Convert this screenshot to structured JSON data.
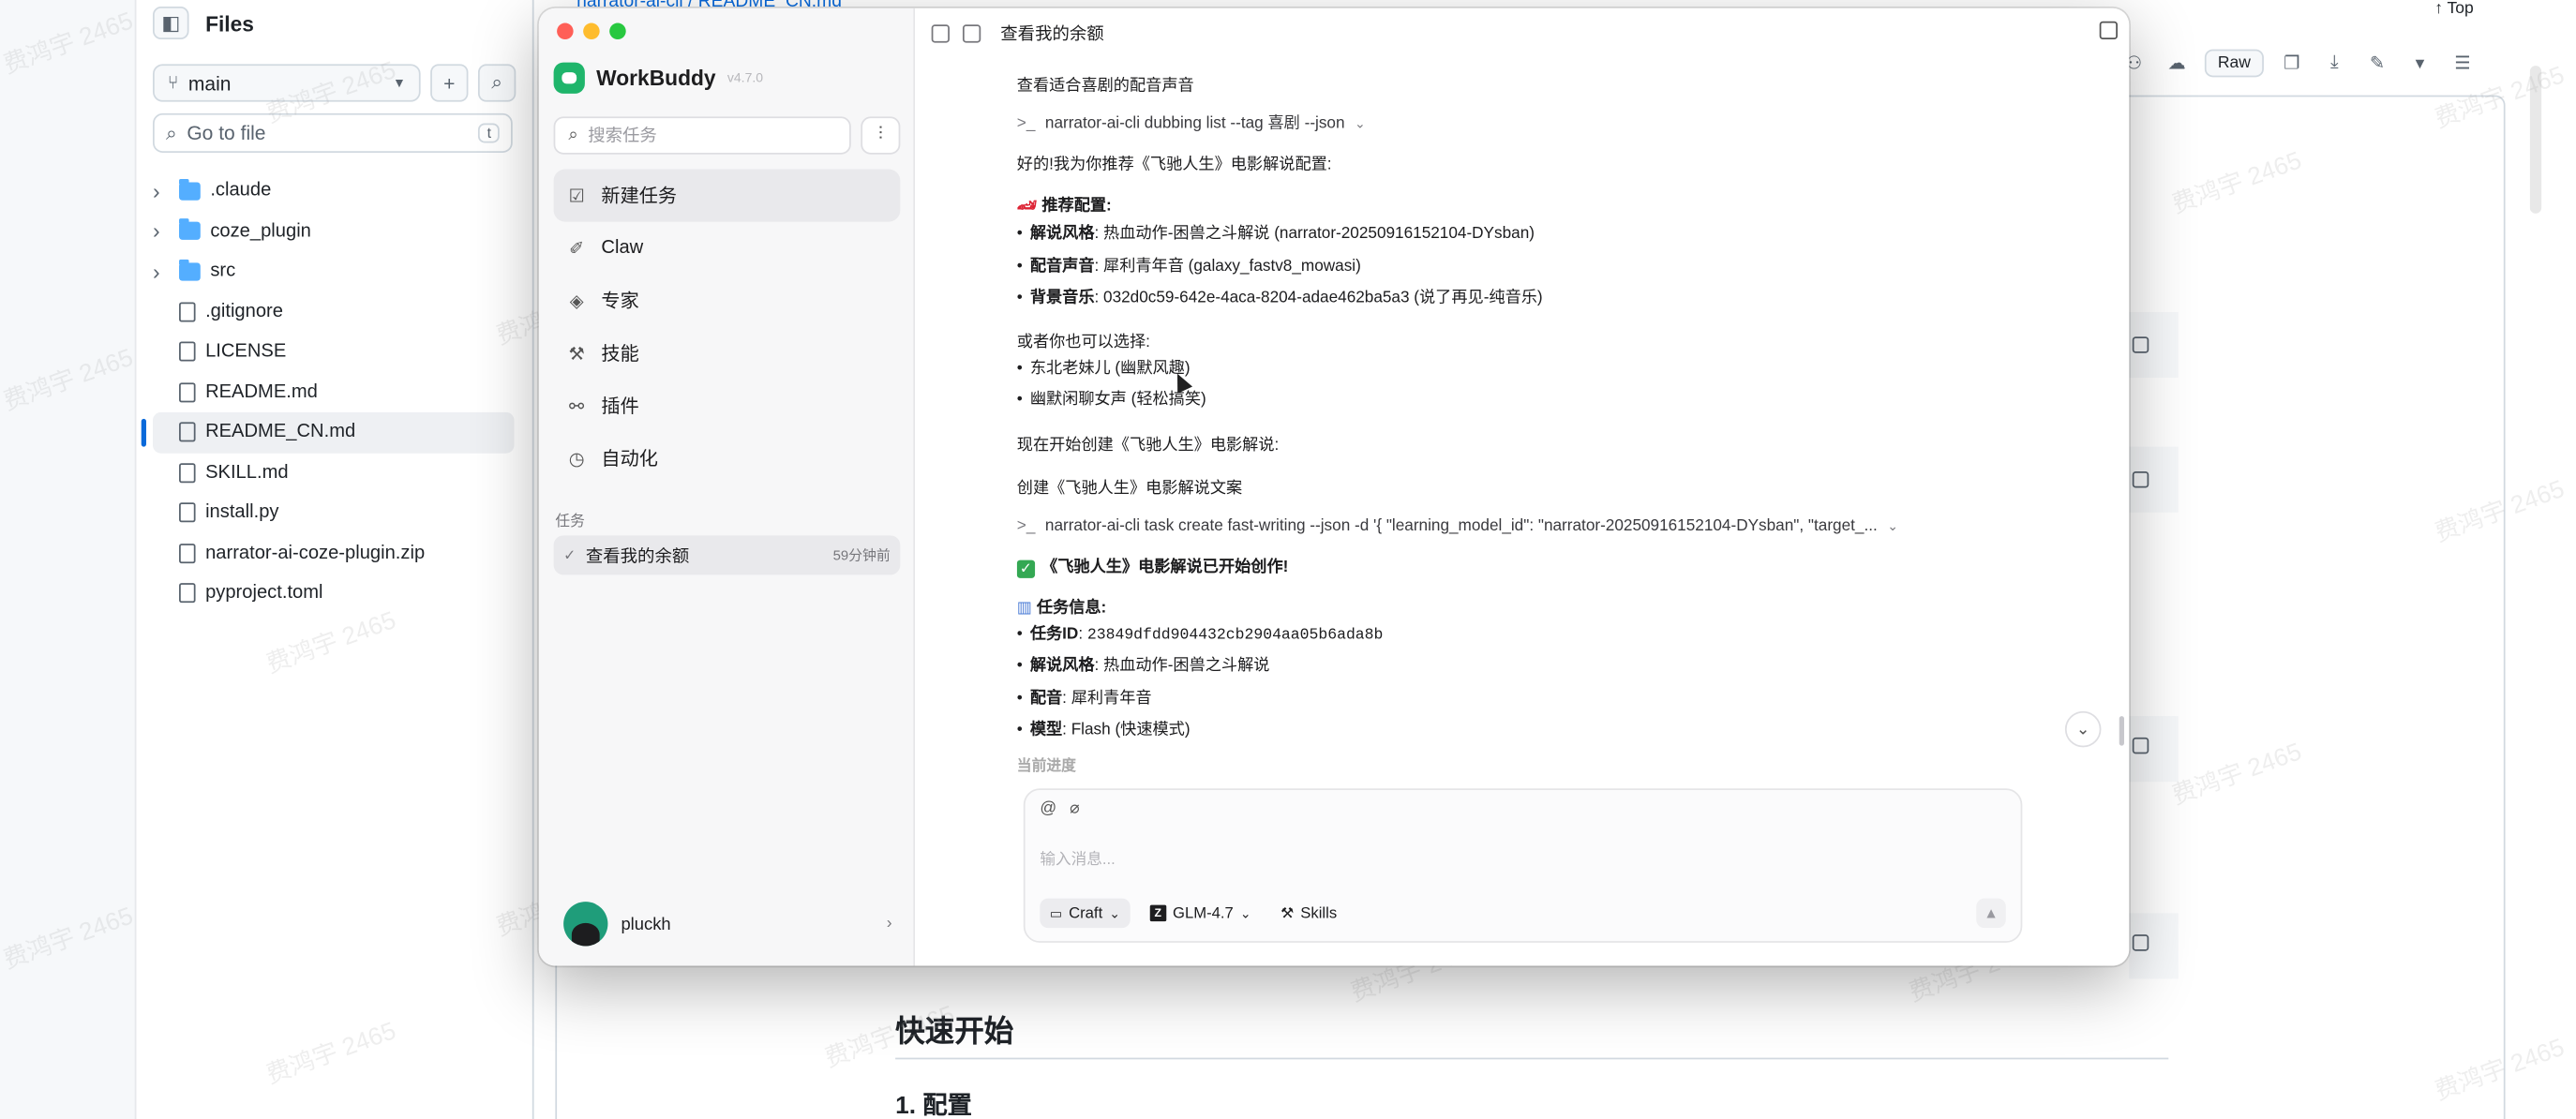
{
  "github": {
    "breadcrumb": "narrator-ai-cli / README_CN.md",
    "files_title": "Files",
    "branch": "main",
    "goto_placeholder": "Go to file",
    "goto_shortcut": "t",
    "tree": [
      {
        "name": ".claude",
        "type": "folder"
      },
      {
        "name": "coze_plugin",
        "type": "folder"
      },
      {
        "name": "src",
        "type": "folder"
      },
      {
        "name": ".gitignore",
        "type": "file"
      },
      {
        "name": "LICENSE",
        "type": "file"
      },
      {
        "name": "README.md",
        "type": "file"
      },
      {
        "name": "README_CN.md",
        "type": "file",
        "selected": true
      },
      {
        "name": "SKILL.md",
        "type": "file"
      },
      {
        "name": "install.py",
        "type": "file"
      },
      {
        "name": "narrator-ai-coze-plugin.zip",
        "type": "file"
      },
      {
        "name": "pyproject.toml",
        "type": "file"
      }
    ],
    "toolbar": {
      "raw": "Raw",
      "top": "Top"
    },
    "heading_quick_start": "快速开始",
    "heading_config": "1. 配置",
    "watermark": "费鸿宇 2465"
  },
  "workbuddy": {
    "app_name": "WorkBuddy",
    "version": "v4.7.0",
    "search_placeholder": "搜索任务",
    "nav": [
      {
        "label": "新建任务",
        "icon": "new-task-icon",
        "active": true
      },
      {
        "label": "Claw",
        "icon": "claw-icon"
      },
      {
        "label": "专家",
        "icon": "expert-icon"
      },
      {
        "label": "技能",
        "icon": "skills-icon"
      },
      {
        "label": "插件",
        "icon": "plugin-icon"
      },
      {
        "label": "自动化",
        "icon": "clock-icon"
      }
    ],
    "tasks_label": "任务",
    "task": {
      "title": "查看我的余额",
      "time": "59分钟前"
    },
    "user": "pluckh",
    "header_title": "查看我的余额",
    "chat": {
      "l1": "查看适合喜剧的配音声音",
      "cmd1": "narrator-ai-cli dubbing list --tag 喜剧 --json",
      "l2": "好的!我为你推荐《飞驰人生》电影解说配置:",
      "rec_title": "推荐配置:",
      "rec": [
        {
          "k": "解说风格",
          "v": ": 热血动作-困兽之斗解说 (narrator-20250916152104-DYsban)"
        },
        {
          "k": "配音声音",
          "v": ": 犀利青年音 (galaxy_fastv8_mowasi)"
        },
        {
          "k": "背景音乐",
          "v": ": 032d0c59-642e-4aca-8204-adae462ba5a3 (说了再见-纯音乐)"
        }
      ],
      "alt_title": "或者你也可以选择:",
      "alt": [
        "东北老妹儿 (幽默风趣)",
        "幽默闲聊女声 (轻松搞笑)"
      ],
      "l3": "现在开始创建《飞驰人生》电影解说:",
      "l4": "创建《飞驰人生》电影解说文案",
      "cmd2": "narrator-ai-cli task create fast-writing --json -d '{ \"learning_model_id\": \"narrator-20250916152104-DYsban\", \"target_...",
      "done": "《飞驰人生》电影解说已开始创作!",
      "info_title": "任务信息:",
      "task_id_k": "任务ID",
      "task_id_v": "23849dfdd904432cb2904aa05b6ada8b",
      "info": [
        {
          "k": "解说风格",
          "v": ": 热血动作-困兽之斗解说"
        },
        {
          "k": "配音",
          "v": ": 犀利青年音"
        },
        {
          "k": "模型",
          "v": ": Flash (快速模式)"
        }
      ],
      "cut": "当前进度"
    },
    "composer": {
      "placeholder": "输入消息...",
      "mode": "Craft",
      "model": "GLM-4.7",
      "skills": "Skills"
    }
  }
}
